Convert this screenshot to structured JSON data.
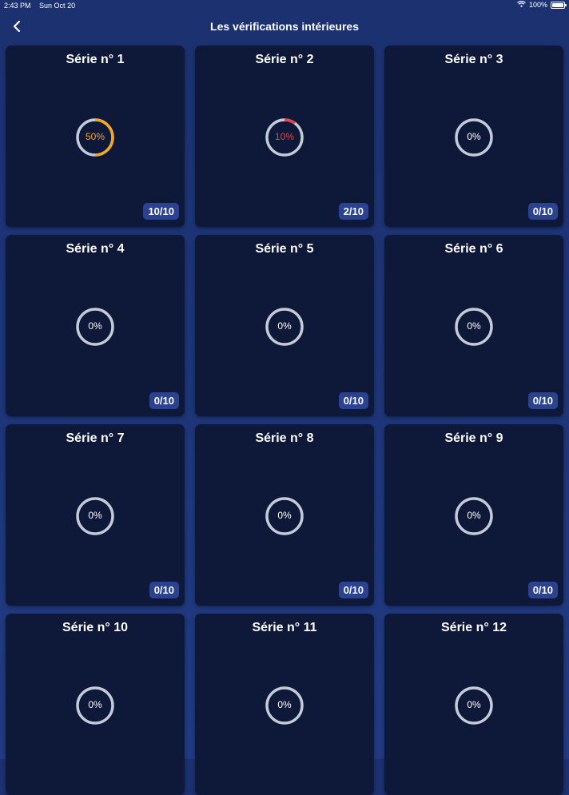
{
  "status_bar": {
    "time": "2:43 PM",
    "date": "Sun Oct 20",
    "battery": "100%"
  },
  "nav": {
    "title": "Les vérifications intérieures"
  },
  "colors": {
    "orange": "#f5a623",
    "red": "#e5424d",
    "track": "#c3ccd6"
  },
  "series": [
    {
      "title": "Série n° 1",
      "percent": "50%",
      "progress": 0.5,
      "color": "#f5a623",
      "count": "10/10"
    },
    {
      "title": "Série n° 2",
      "percent": "10%",
      "progress": 0.1,
      "color": "#e5424d",
      "count": "2/10"
    },
    {
      "title": "Série n° 3",
      "percent": "0%",
      "progress": 0,
      "color": "#ffffff",
      "count": "0/10"
    },
    {
      "title": "Série n° 4",
      "percent": "0%",
      "progress": 0,
      "color": "#ffffff",
      "count": "0/10"
    },
    {
      "title": "Série n° 5",
      "percent": "0%",
      "progress": 0,
      "color": "#ffffff",
      "count": "0/10"
    },
    {
      "title": "Série n° 6",
      "percent": "0%",
      "progress": 0,
      "color": "#ffffff",
      "count": "0/10"
    },
    {
      "title": "Série n° 7",
      "percent": "0%",
      "progress": 0,
      "color": "#ffffff",
      "count": "0/10"
    },
    {
      "title": "Série n° 8",
      "percent": "0%",
      "progress": 0,
      "color": "#ffffff",
      "count": "0/10"
    },
    {
      "title": "Série n° 9",
      "percent": "0%",
      "progress": 0,
      "color": "#ffffff",
      "count": "0/10"
    },
    {
      "title": "Série n° 10",
      "percent": "0%",
      "progress": 0,
      "color": "#ffffff"
    },
    {
      "title": "Série n° 11",
      "percent": "0%",
      "progress": 0,
      "color": "#ffffff"
    },
    {
      "title": "Série n° 12",
      "percent": "0%",
      "progress": 0,
      "color": "#ffffff"
    }
  ]
}
